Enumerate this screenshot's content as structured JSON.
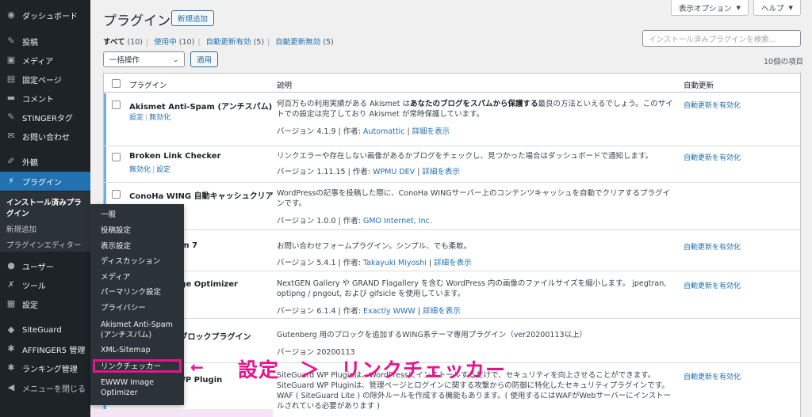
{
  "sidebar": {
    "items": [
      {
        "label": "ダッシュボード",
        "icon": "dashboard-icon",
        "glyph": "◉"
      },
      {
        "label": "投稿",
        "icon": "pin-icon",
        "glyph": "✎"
      },
      {
        "label": "メディア",
        "icon": "media-icon",
        "glyph": "▣"
      },
      {
        "label": "固定ページ",
        "icon": "page-icon",
        "glyph": "▤"
      },
      {
        "label": "コメント",
        "icon": "comment-icon",
        "glyph": "▬"
      },
      {
        "label": "STINGERタグ",
        "icon": "pin-icon",
        "glyph": "✎"
      },
      {
        "label": "お問い合わせ",
        "icon": "mail-icon",
        "glyph": "✉"
      },
      {
        "label": "外観",
        "icon": "brush-icon",
        "glyph": "✐"
      },
      {
        "label": "プラグイン",
        "icon": "plugin-icon",
        "glyph": "⚡"
      },
      {
        "label": "ユーザー",
        "icon": "user-icon",
        "glyph": "●"
      },
      {
        "label": "ツール",
        "icon": "wrench-icon",
        "glyph": "✗"
      },
      {
        "label": "設定",
        "icon": "settings-icon",
        "glyph": "▦"
      },
      {
        "label": "SiteGuard",
        "icon": "shield-icon",
        "glyph": "◆"
      },
      {
        "label": "AFFINGER5 管理",
        "icon": "gear-icon",
        "glyph": "✱"
      },
      {
        "label": "ランキング管理",
        "icon": "gear-icon",
        "glyph": "✱"
      },
      {
        "label": "メニューを閉じる",
        "icon": "collapse-icon",
        "glyph": "◀"
      }
    ],
    "submenu": {
      "installed": "インストール済みプラグイン",
      "installed_line1": "インストール済みプラ",
      "installed_line2": "グイン",
      "add_new": "新規追加",
      "editor": "プラグインエディター"
    }
  },
  "flyout": {
    "items": [
      "一般",
      "投稿設定",
      "表示設定",
      "ディスカッション",
      "メディア",
      "パーマリンク設定",
      "プライバシー",
      "Akismet Anti-Spam",
      "(アンチスパム)",
      "XML-Sitemap",
      "リンクチェッカー",
      "EWWW Image",
      "Optimizer"
    ]
  },
  "header": {
    "screen_options": "表示オプション",
    "help": "ヘルプ",
    "title": "プラグイン",
    "add_new": "新規追加"
  },
  "filters": {
    "all": "すべて",
    "all_count": "(10)",
    "active": "使用中",
    "active_count": "(10)",
    "auto_on": "自動更新有効",
    "auto_on_count": "(5)",
    "auto_off": "自動更新無効",
    "auto_off_count": "(5)"
  },
  "search": {
    "placeholder": "インストール済みプラグインを検索..."
  },
  "bulk": {
    "selected": "一括操作",
    "apply": "適用",
    "count": "10個の項目"
  },
  "table": {
    "headers": {
      "plugin": "プラグイン",
      "description": "説明",
      "auto_update": "自動更新"
    },
    "rows": [
      {
        "name": "Akismet Anti-Spam (アンチスパム)",
        "actions": [
          "設定",
          "無効化"
        ],
        "desc_pre": "何百万もの利用実績がある Akismet は",
        "desc_bold": "あなたのブログをスパムから保護する",
        "desc_post": "最良の方法といえるでしょう。このサイトでの設定は完了しており Akismet が常時保護しています。",
        "version": "バージョン 4.1.9 | 作者: ",
        "author": "Automattic",
        "details": "詳細を表示",
        "auto": "自動更新を有効化"
      },
      {
        "name": "Broken Link Checker",
        "actions": [
          "無効化",
          "設定"
        ],
        "desc_pre": "リンクエラーや存在しない画像があるかブログをチェックし、見つかった場合はダッシュボードで通知します。",
        "desc_bold": "",
        "desc_post": "",
        "version": "バージョン 1.11.15 | 作者: ",
        "author": "WPMU DEV",
        "details": "詳細を表示",
        "auto": "自動更新を有効化"
      },
      {
        "name": "ConoHa WING 自動キャッシュクリア",
        "actions": [],
        "desc_pre": "WordPressの記事を投稿した際に、ConoHa WINGサーバー上のコンテンツキャッシュを自動でクリアするプラグインです。",
        "desc_bold": "",
        "desc_post": "",
        "version": "バージョン 1.0.0 | 作者: ",
        "author": "GMO Internet, Inc.",
        "details": "",
        "auto": ""
      },
      {
        "name": "Contact Form 7",
        "actions": [],
        "desc_pre": "お問い合わせフォームプラグイン。シンプル、でも柔軟。",
        "desc_bold": "",
        "desc_post": "",
        "version": "バージョン 5.4.1 | 作者: ",
        "author": "Takayuki Miyoshi",
        "details": "詳細を表示",
        "auto": "自動更新を有効化"
      },
      {
        "name": "EWWW Image Optimizer",
        "actions": [],
        "desc_pre": "NextGEN Gallery や GRAND Flagallery を含む WordPress 内の画像のファイルサイズを縮小します。 jpegtran, optipng / pngout, および gifsicle を使用しています。",
        "desc_bold": "",
        "desc_post": "",
        "version": "バージョン 6.1.4 | 作者: ",
        "author": "Exactly WWW",
        "details": "詳細を表示",
        "auto": "自動更新を有効化"
      },
      {
        "name": "Gutenberg ブロックプラグイン",
        "actions": [],
        "desc_pre": "Gutenberg 用のブロックを追加するWING系テーマ専用プラグイン（ver20200113以上）",
        "desc_bold": "",
        "desc_post": "",
        "version": "バージョン 20200113",
        "author": "",
        "details": "",
        "auto": ""
      },
      {
        "name": "SiteGuard WP Plugin",
        "actions": [],
        "desc_pre": "SiteGuard WP Pluginは、WordPressにインストールするだけで、セキュリティを向上させることができます。SiteGuard WP Pluginは、管理ページとログインに関する攻撃からの防御に特化したセキュリティプラグインです。WAF ( SiteGuard Lite ) の除外ルールを作成する機能もあります。( 使用するにはWAFがWebサーバーにインストールされている必要があります )",
        "desc_bold": "",
        "desc_post": "",
        "version": "",
        "author": "",
        "details": "",
        "auto": "自動更新を有効化"
      }
    ]
  },
  "annotation": {
    "arrow": "←",
    "text": "設定　＞　リンクチェッカー"
  },
  "colors": {
    "accent": "#2271b1",
    "annotation": "#e8138c",
    "sidebar_bg": "#1d2327"
  }
}
